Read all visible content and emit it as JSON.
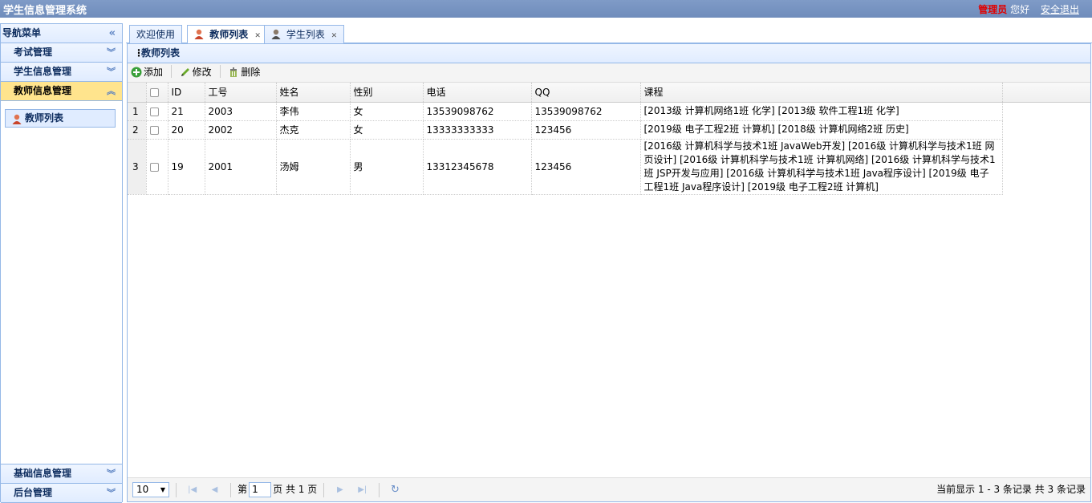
{
  "app": {
    "title": "学生信息管理系统"
  },
  "user": {
    "role": "管理员",
    "greeting": "您好",
    "logout": "安全退出"
  },
  "sidebar": {
    "header": "导航菜单",
    "collapse_icon": "«",
    "top_sections": [
      {
        "label": "考试管理"
      },
      {
        "label": "学生信息管理"
      },
      {
        "label": "教师信息管理",
        "active": true
      }
    ],
    "active_items": [
      {
        "label": "教师列表",
        "icon": "teacher-icon"
      }
    ],
    "bottom_sections": [
      {
        "label": "基础信息管理"
      },
      {
        "label": "后台管理"
      }
    ]
  },
  "tabs": [
    {
      "label": "欢迎使用",
      "closable": false
    },
    {
      "label": "教师列表",
      "closable": true,
      "selected": true,
      "icon": "teacher-icon"
    },
    {
      "label": "学生列表",
      "closable": true,
      "icon": "student-icon"
    }
  ],
  "panel": {
    "title": "教师列表"
  },
  "toolbar": {
    "add": "添加",
    "edit": "修改",
    "delete": "删除"
  },
  "grid": {
    "columns": [
      "ID",
      "工号",
      "姓名",
      "性别",
      "电话",
      "QQ",
      "课程"
    ],
    "rows": [
      {
        "rn": "1",
        "id": "21",
        "no": "2003",
        "name": "李伟",
        "sex": "女",
        "phone": "13539098762",
        "qq": "13539098762",
        "course": "[2013级 计算机网络1班 化学]   [2013级 软件工程1班 化学]"
      },
      {
        "rn": "2",
        "id": "20",
        "no": "2002",
        "name": "杰克",
        "sex": "女",
        "phone": "13333333333",
        "qq": "123456",
        "course": "[2019级 电子工程2班 计算机]   [2018级 计算机网络2班 历史]"
      },
      {
        "rn": "3",
        "id": "19",
        "no": "2001",
        "name": "汤姆",
        "sex": "男",
        "phone": "13312345678",
        "qq": "123456",
        "course": "[2016级 计算机科学与技术1班 JavaWeb开发]   [2016级 计算机科学与技术1班 网页设计]   [2016级 计算机科学与技术1班 计算机网络]   [2016级 计算机科学与技术1班 JSP开发与应用]   [2016级 计算机科学与技术1班 Java程序设计]    [2019级 电子工程1班 Java程序设计]   [2019级 电子工程2班 计算机]"
      }
    ]
  },
  "pager": {
    "page_size": "10",
    "page_prefix": "第",
    "page_value": "1",
    "page_suffix": "页 共 1 页",
    "info": "当前显示 1 - 3 条记录 共 3 条记录"
  }
}
